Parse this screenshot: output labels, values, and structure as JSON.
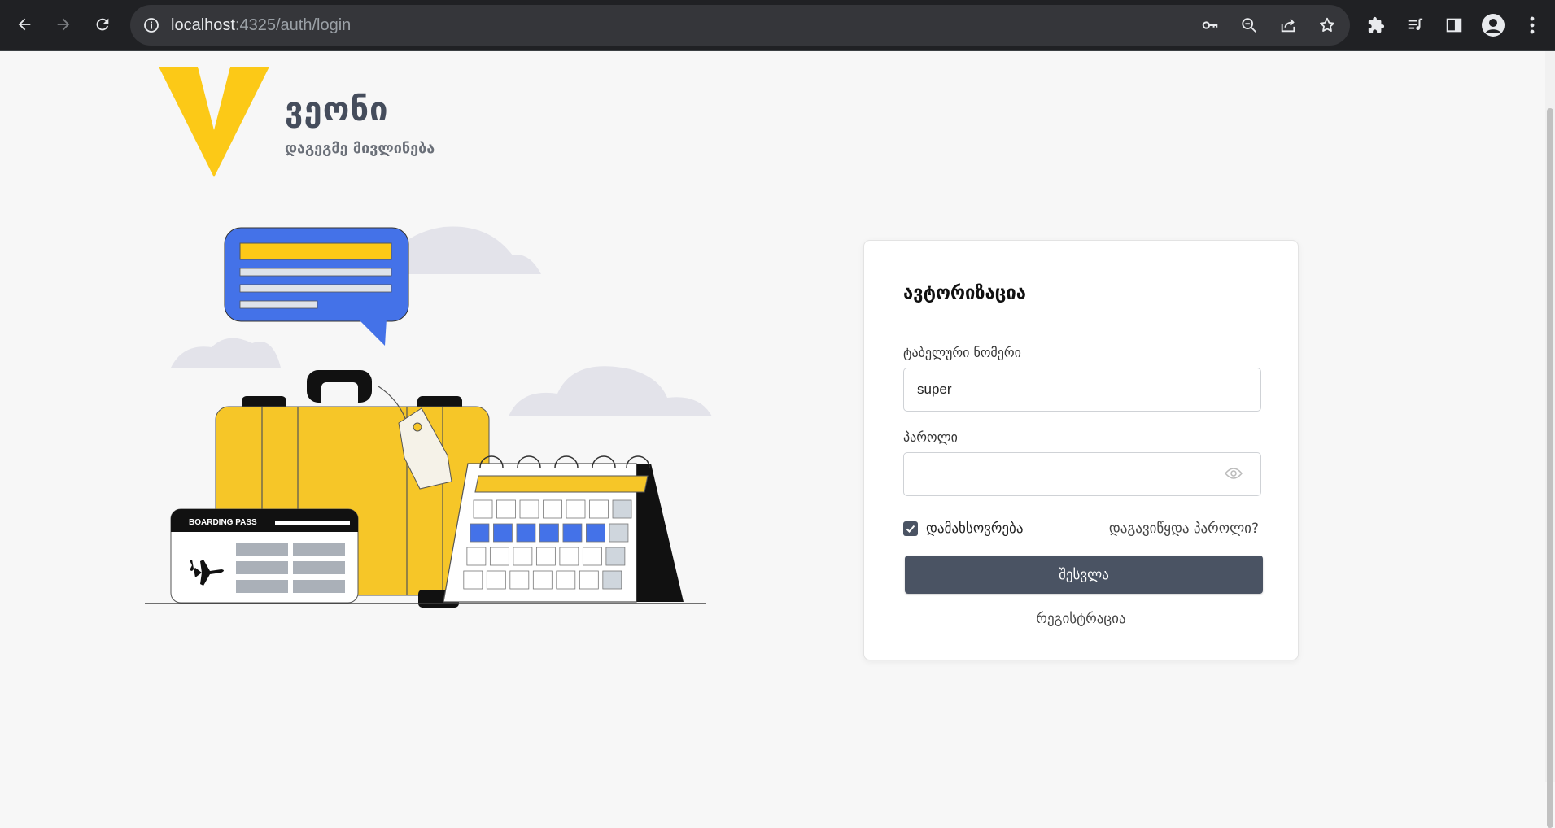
{
  "browser": {
    "url_host": "localhost",
    "url_path": ":4325/auth/login",
    "icons": {
      "back": "arrow-left-icon",
      "forward": "arrow-right-icon",
      "reload": "reload-icon",
      "site_info": "info-icon",
      "password": "key-icon",
      "zoom": "zoom-out-icon",
      "share": "share-icon",
      "bookmark": "star-icon",
      "extensions": "puzzle-icon",
      "media": "media-queue-icon",
      "side_panel": "side-panel-icon",
      "profile": "profile-icon",
      "menu": "kebab-menu-icon"
    }
  },
  "brand": {
    "name": "ვეონი",
    "tagline": "დაგეგმე მივლინება",
    "logo_color": "#fcc917"
  },
  "illustration": {
    "boarding_pass_text": "BOARDING PASS"
  },
  "login": {
    "title": "ავტორიზაცია",
    "employee_number_label": "ტაბელური ნომერი",
    "employee_number_value": "super",
    "password_label": "პაროლი",
    "password_value": "",
    "remember_label": "დამახსოვრება",
    "remember_checked": true,
    "forgot_label": "დაგავიწყდა პაროლი?",
    "submit_label": "შესვლა",
    "register_label": "რეგისტრაცია"
  },
  "colors": {
    "accent": "#4a5363",
    "brand_yellow": "#fcc917",
    "bubble_blue": "#4472e8"
  }
}
